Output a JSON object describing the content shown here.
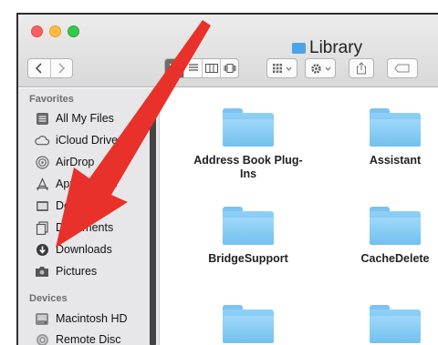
{
  "window": {
    "title": "Library",
    "colors": {
      "close": "#fc605c",
      "minimize": "#fdbc40",
      "zoom": "#34c84a"
    }
  },
  "toolbar": {
    "back_icon": "chevron-left-icon",
    "forward_icon": "chevron-right-icon",
    "view_modes": [
      "icon-view",
      "list-view",
      "column-view",
      "cover-flow-view"
    ],
    "arrange_icon": "grid-arrange-icon",
    "action_icon": "gear-icon",
    "share_icon": "share-icon",
    "tag_icon": "tag-icon"
  },
  "sidebar": {
    "favorites_heading": "Favorites",
    "devices_heading": "Devices",
    "favorites": [
      {
        "label": "All My Files",
        "icon": "all-files-icon"
      },
      {
        "label": "iCloud Drive",
        "icon": "cloud-icon"
      },
      {
        "label": "AirDrop",
        "icon": "airdrop-icon"
      },
      {
        "label": "Applications",
        "icon": "applications-icon"
      },
      {
        "label": "Desktop",
        "icon": "desktop-icon"
      },
      {
        "label": "Documents",
        "icon": "documents-icon"
      },
      {
        "label": "Downloads",
        "icon": "downloads-icon"
      },
      {
        "label": "Pictures",
        "icon": "pictures-icon"
      }
    ],
    "devices": [
      {
        "label": "Macintosh HD",
        "icon": "hard-drive-icon"
      },
      {
        "label": "Remote Disc",
        "icon": "disc-icon"
      }
    ]
  },
  "files": [
    {
      "name": "Address Book Plug-",
      "name2": "Ins"
    },
    {
      "name": "Assistant",
      "name2": ""
    },
    {
      "name": "BridgeSupport",
      "name2": ""
    },
    {
      "name": "CacheDelete",
      "name2": ""
    },
    {
      "name": "",
      "name2": ""
    },
    {
      "name": "",
      "name2": ""
    }
  ],
  "annotation": {
    "color": "#e8312a",
    "icon": "red-arrow-icon"
  }
}
